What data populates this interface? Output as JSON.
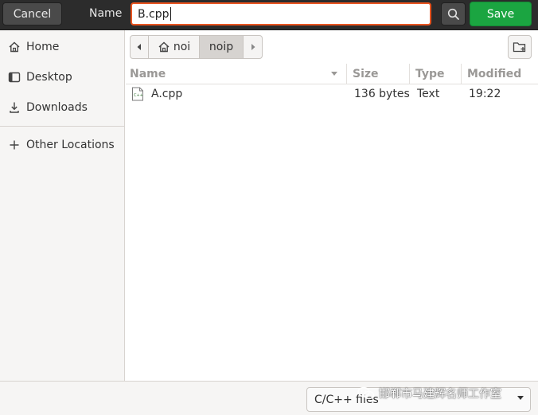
{
  "header": {
    "cancel_label": "Cancel",
    "name_label": "Name",
    "filename_value": "B.cpp",
    "save_label": "Save",
    "search_icon": "search-icon",
    "accent_color": "#e95420",
    "save_color": "#1ba541"
  },
  "sidebar": {
    "items": [
      {
        "label": "Home",
        "icon": "home-icon"
      },
      {
        "label": "Desktop",
        "icon": "desktop-icon"
      },
      {
        "label": "Downloads",
        "icon": "download-icon"
      },
      {
        "label": "Other Locations",
        "icon": "plus-icon"
      }
    ]
  },
  "pathbar": {
    "segments": [
      "noi",
      "noip"
    ],
    "back_icon": "chevron-left-icon",
    "forward_icon": "chevron-right-icon",
    "new_folder_icon": "new-folder-icon"
  },
  "file_list": {
    "columns": [
      "Name",
      "Size",
      "Type",
      "Modified"
    ],
    "sort_column": "Name",
    "rows": [
      {
        "name": "A.cpp",
        "size": "136 bytes",
        "type": "Text",
        "modified": "19:22",
        "icon": "cpp-file-icon"
      }
    ]
  },
  "footer": {
    "filter_value": "C/C++ files",
    "watermark_text": "邯郸市马建辉名师工作室"
  }
}
